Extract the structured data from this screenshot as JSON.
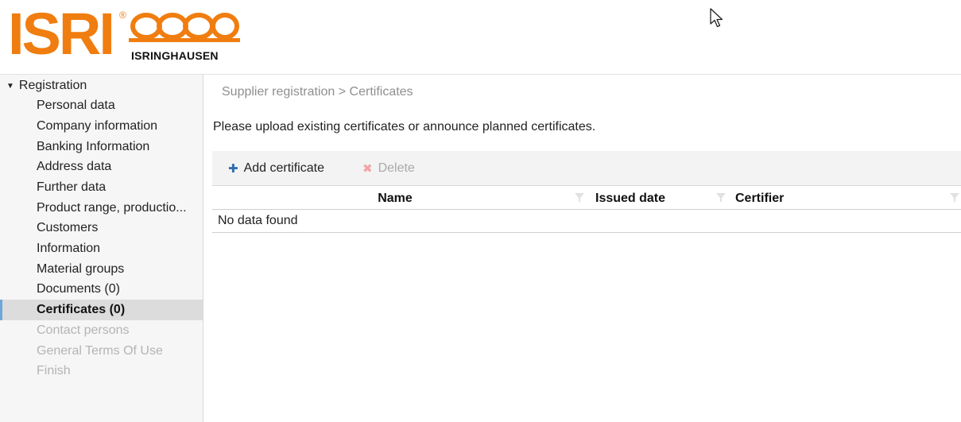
{
  "header": {
    "logo_main": "ISRI",
    "logo_registered": "®",
    "logo_sub": "ISRINGHAUSEN",
    "brand_color": "#f07d0f"
  },
  "sidebar": {
    "root_label": "Registration",
    "items": [
      {
        "label": "Personal data",
        "state": "normal"
      },
      {
        "label": "Company information",
        "state": "normal"
      },
      {
        "label": "Banking Information",
        "state": "normal"
      },
      {
        "label": "Address data",
        "state": "normal"
      },
      {
        "label": "Further data",
        "state": "normal"
      },
      {
        "label": "Product range, productio...",
        "state": "normal"
      },
      {
        "label": "Customers",
        "state": "normal"
      },
      {
        "label": "Information",
        "state": "normal"
      },
      {
        "label": "Material groups",
        "state": "normal"
      },
      {
        "label": "Documents (0)",
        "state": "normal"
      },
      {
        "label": "Certificates (0)",
        "state": "active"
      },
      {
        "label": "Contact persons",
        "state": "disabled"
      },
      {
        "label": "General Terms Of Use",
        "state": "disabled"
      },
      {
        "label": "Finish",
        "state": "disabled"
      }
    ]
  },
  "main": {
    "breadcrumb": "Supplier registration > Certificates",
    "intro": "Please upload existing certificates or announce planned certificates.",
    "toolbar": {
      "add_label": "Add certificate",
      "add_icon": "plus-icon",
      "delete_label": "Delete",
      "delete_icon": "x-icon"
    },
    "table": {
      "columns": [
        "Name",
        "Issued date",
        "Certifier"
      ],
      "empty_text": "No data found"
    }
  }
}
